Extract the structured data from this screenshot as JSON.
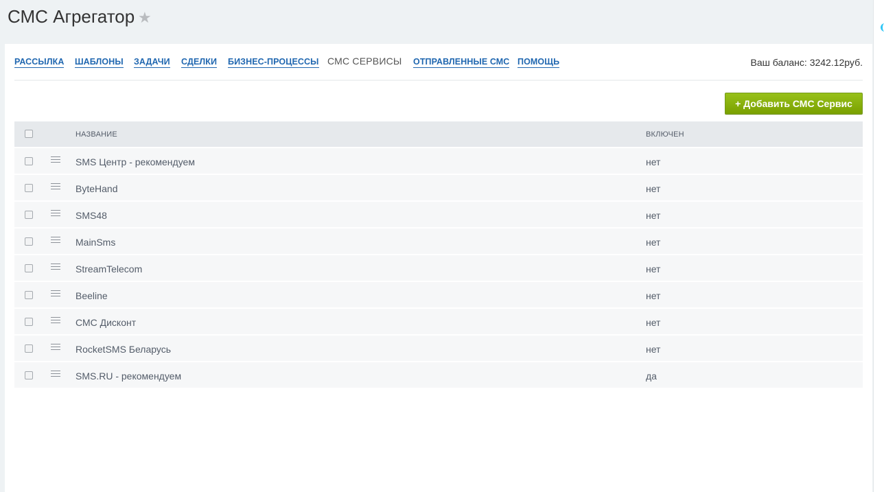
{
  "header": {
    "title": "СМС Агрегатор",
    "star_icon": "star-icon"
  },
  "nav": {
    "items": [
      {
        "label": "РАССЫЛКА",
        "active": false
      },
      {
        "label": "ШАБЛОНЫ",
        "active": false
      },
      {
        "label": "ЗАДАЧИ",
        "active": false
      },
      {
        "label": "СДЕЛКИ",
        "active": false
      },
      {
        "label": "БИЗНЕС-ПРОЦЕССЫ",
        "active": false
      },
      {
        "label": "СМС СЕРВИСЫ",
        "active": true
      },
      {
        "label": "ОТПРАВЛЕННЫЕ СМС",
        "active": false
      },
      {
        "label": "ПОМОЩЬ",
        "active": false
      }
    ],
    "balance": "Ваш баланс: 3242.12руб."
  },
  "toolbar": {
    "add_label": "+ Добавить СМС Сервис"
  },
  "grid": {
    "columns": [
      "НАЗВАНИЕ",
      "ВКЛЮЧЕН"
    ],
    "rows": [
      {
        "name": "SMS Центр - рекомендуем",
        "enabled": "нет"
      },
      {
        "name": "ByteHand",
        "enabled": "нет"
      },
      {
        "name": "SMS48",
        "enabled": "нет"
      },
      {
        "name": "MainSms",
        "enabled": "нет"
      },
      {
        "name": "StreamTelecom",
        "enabled": "нет"
      },
      {
        "name": "Beeline",
        "enabled": "нет"
      },
      {
        "name": "СМС Дисконт",
        "enabled": "нет"
      },
      {
        "name": "RocketSMS Беларусь",
        "enabled": "нет"
      },
      {
        "name": "SMS.RU - рекомендуем",
        "enabled": "да"
      }
    ]
  },
  "colors": {
    "link": "#2067b0",
    "add_button": "#86ad00",
    "page_bg": "#eef2f4",
    "grid_header_bg": "#e6e9ec",
    "row_bg": "#f6f7f8"
  }
}
